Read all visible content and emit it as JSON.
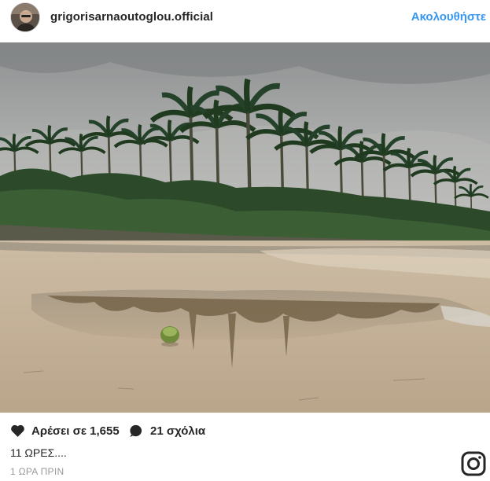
{
  "post": {
    "username": "grigorisarnaoutoglou.official",
    "follow_label": "Ακολουθήστε",
    "likes_label": "Αρέσει σε 1,655",
    "comments_label": "21 σχόλια",
    "caption": "11 ΩΡΕΣ....",
    "timestamp": "1 ΩΡΑ ΠΡΙΝ"
  },
  "colors": {
    "accent": "#3897f0",
    "text": "#262626",
    "muted": "#999999"
  },
  "icons": {
    "like": "heart-icon",
    "comment": "comment-icon",
    "brand": "instagram-logo-icon"
  }
}
